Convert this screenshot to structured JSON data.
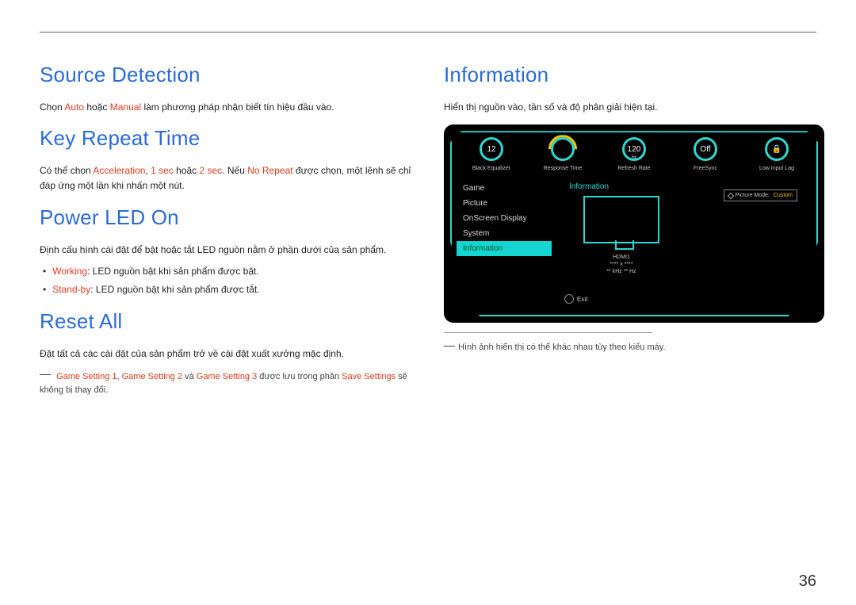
{
  "pageNumber": "36",
  "left": {
    "sourceDetection": {
      "title": "Source Detection",
      "body_pre": "Chọn ",
      "auto": "Auto",
      "body_mid": " hoặc ",
      "manual": "Manual",
      "body_post": " làm phương pháp nhận biết tín hiệu đầu vào."
    },
    "keyRepeat": {
      "title": "Key Repeat Time",
      "body_pre": "Có thể chọn ",
      "acc": "Acceleration",
      "sep1": ", ",
      "sec1": "1 sec",
      "sep2": " hoặc ",
      "sec2": "2 sec",
      "mid": ". Nếu ",
      "norepeat": "No Repeat",
      "post": " được chọn, một lệnh sẽ chỉ đáp ứng một lần khi nhấn một nút."
    },
    "powerLed": {
      "title": "Power LED On",
      "body": "Định cấu hình cài đặt để bật hoặc tắt LED nguồn nằm ở phần dưới của sản phẩm.",
      "b1k": "Working",
      "b1v": ": LED nguồn bật khi sản phẩm được bật.",
      "b2k": "Stand-by",
      "b2v": ": LED nguồn bật khi sản phẩm được tắt."
    },
    "resetAll": {
      "title": "Reset All",
      "body": "Đặt tất cả các cài đặt của sản phẩm trở về cài đặt xuất xưởng mặc định.",
      "fn_g1": "Game Setting 1",
      "fn_sep1": ", ",
      "fn_g2": "Game Setting 2",
      "fn_sep2": " và ",
      "fn_g3": "Game Setting 3",
      "fn_mid": " được lưu trong phần ",
      "fn_save": "Save Settings",
      "fn_post": " sẽ không bị thay đổi."
    }
  },
  "right": {
    "information": {
      "title": "Information",
      "body": "Hiển thị nguồn vào, tần số và độ phân giải hiện tại.",
      "footnote": "Hình ảnh hiển thị có thể khác nhau tùy theo kiểu máy."
    }
  },
  "osd": {
    "dials": [
      {
        "value": "12",
        "label": "Black Equalizer"
      },
      {
        "value": "",
        "label": "Response Time",
        "gauge": true
      },
      {
        "value": "120",
        "sub": "Hz",
        "label": "Refresh Rate"
      },
      {
        "value": "Off",
        "label": "FreeSync"
      },
      {
        "value": "🔒",
        "label": "Low Input Lag"
      }
    ],
    "menu": [
      "Game",
      "Picture",
      "OnScreen Display",
      "System",
      "Information"
    ],
    "menuSelectedIndex": 4,
    "panelTitle": "Information",
    "pictureModeLabel": "Picture Mode:",
    "pictureModeValue": "Custom",
    "source": "HDMI1",
    "resolution": "**** x ****",
    "freq": "** kHz  ** Hz",
    "exit": "Exit"
  }
}
